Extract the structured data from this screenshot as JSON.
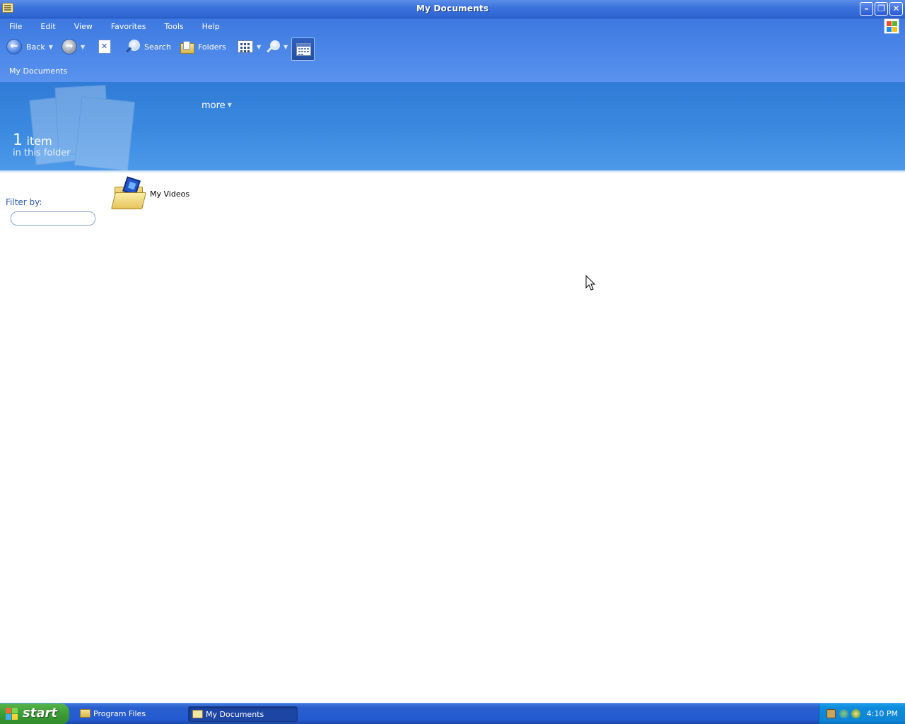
{
  "window": {
    "title": "My Documents",
    "buttons": {
      "minimize": "–",
      "restore": "❐",
      "close": "✕"
    }
  },
  "menu": {
    "items": [
      "File",
      "Edit",
      "View",
      "Favorites",
      "Tools",
      "Help"
    ]
  },
  "toolbar": {
    "back_label": "Back",
    "search_label": "Search",
    "folders_label": "Folders"
  },
  "address": {
    "text": "My Documents"
  },
  "banner": {
    "count": "1",
    "count_unit": "item",
    "count_sub": "in this folder",
    "more_label": "more"
  },
  "filter": {
    "label": "Filter by:",
    "value": ""
  },
  "items": [
    {
      "name": "My Videos",
      "icon": "my-videos-folder-icon"
    }
  ],
  "taskbar": {
    "start_label": "start",
    "tasks": [
      {
        "label": "Program Files",
        "active": false
      },
      {
        "label": "My Documents",
        "active": true
      }
    ],
    "clock": "4:10 PM"
  },
  "colors": {
    "titlebar": "#3a72dc",
    "banner": "#3b8ae0",
    "start_button": "#3c9c36",
    "tray": "#0f8bde",
    "filter_label": "#2a5ab0"
  }
}
